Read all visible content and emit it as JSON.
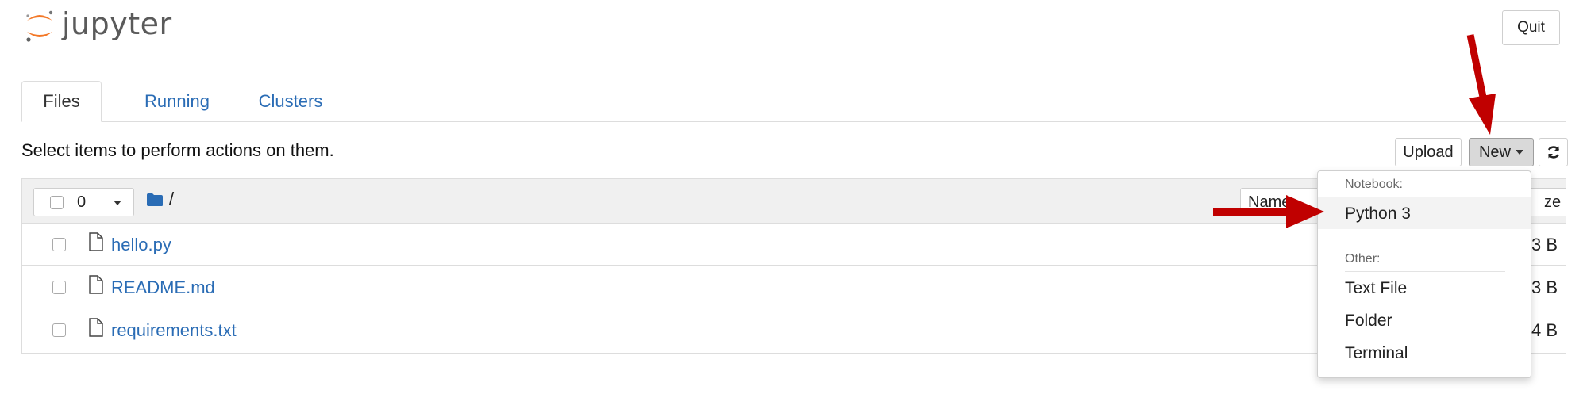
{
  "header": {
    "logo_text": "jupyter",
    "quit_label": "Quit"
  },
  "tabs": [
    {
      "label": "Files",
      "active": true
    },
    {
      "label": "Running",
      "active": false
    },
    {
      "label": "Clusters",
      "active": false
    }
  ],
  "toolbar": {
    "instruction": "Select items to perform actions on them.",
    "upload_label": "Upload",
    "new_label": "New"
  },
  "list": {
    "selected_count": "0",
    "path": "/",
    "name_column": "Name",
    "size_column": "ze",
    "files": [
      {
        "name": "hello.py",
        "size": "3 B"
      },
      {
        "name": "README.md",
        "size": "3 B"
      },
      {
        "name": "requirements.txt",
        "size": "4 B"
      }
    ]
  },
  "new_menu": {
    "notebook_header": "Notebook:",
    "python3": "Python 3",
    "other_header": "Other:",
    "text_file": "Text File",
    "folder": "Folder",
    "terminal": "Terminal"
  },
  "colors": {
    "link": "#2a6cb5",
    "accent_orange": "#f37726",
    "annotation_arrow": "#c00000"
  }
}
